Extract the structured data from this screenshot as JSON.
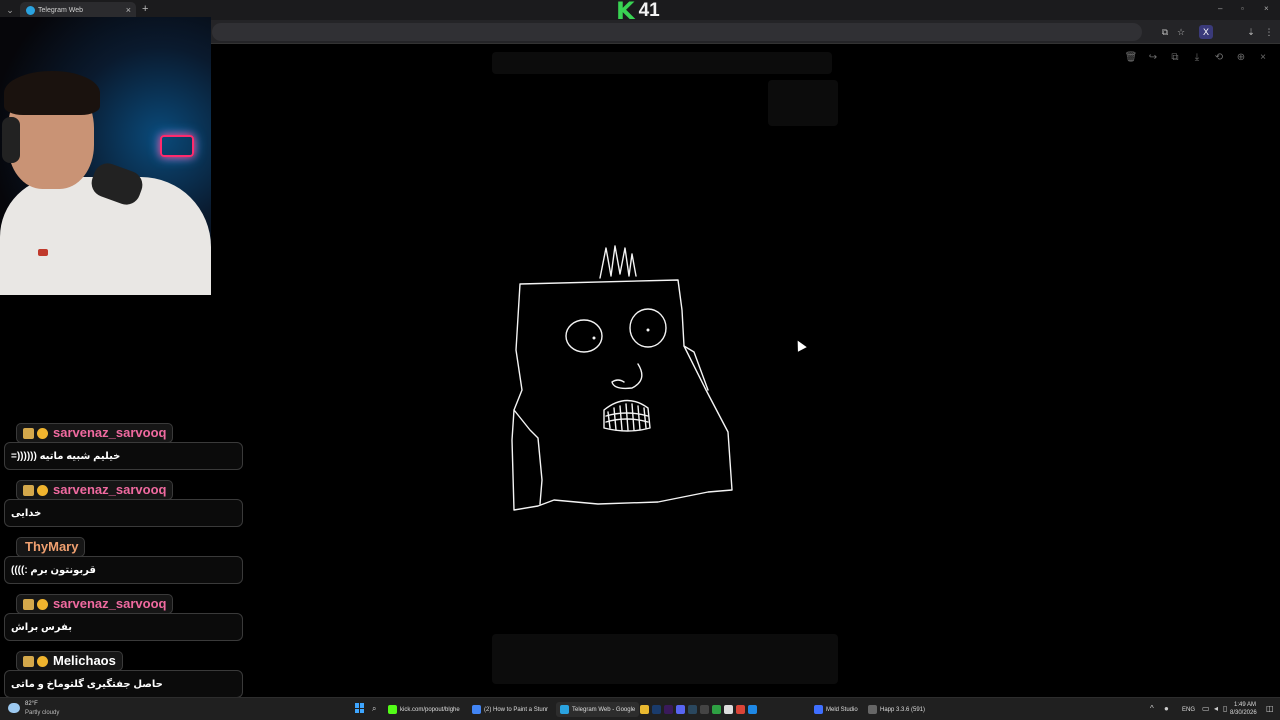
{
  "browser": {
    "tab_title": "Telegram Web",
    "tab_close": "×",
    "new_tab": "+",
    "tab_menu": "⌄",
    "window_controls": [
      "–",
      "▫",
      "×"
    ],
    "toolbar_icons": [
      "⧉",
      "☆",
      "X",
      "⇣",
      "⋮"
    ]
  },
  "overlay_score": {
    "logo": "K",
    "value": "41"
  },
  "viewer": {
    "tools": [
      "🗑",
      "↪",
      "⧉",
      "⤓",
      "⟲",
      "⊕",
      "×"
    ],
    "image_subject": "white line drawing of a square creature with spiky hair, oval eyes, nose and toothy mouth"
  },
  "chat": [
    {
      "username": "sarvenaz_sarvooq",
      "username_color": "#f06aa0",
      "badges": true,
      "message": "خیلیم شبیه ماتیه ((((((="
    },
    {
      "username": "sarvenaz_sarvooq",
      "username_color": "#f06aa0",
      "badges": true,
      "message": "خدایی"
    },
    {
      "username": "ThyMary",
      "username_color": "#f0a070",
      "badges": false,
      "message": "قربونتون برم :))))"
    },
    {
      "username": "sarvenaz_sarvooq",
      "username_color": "#f06aa0",
      "badges": true,
      "message": "بفرس براش"
    },
    {
      "username": "Melichaos",
      "username_color": "#ffffff",
      "badges": true,
      "message": "حاصل جفتگیری گلتوماخ و ماتی"
    }
  ],
  "taskbar": {
    "weather_temp": "82°F",
    "weather_condition": "Partly cloudy",
    "apps": [
      {
        "label": "kick.com/popout/blghe",
        "icon_color": "#53fc18"
      },
      {
        "label": "(2) How to Paint a Stunr",
        "icon_color": "#4285f4"
      },
      {
        "label": "Telegram Web - Google",
        "icon_color": "#2aa3e0"
      },
      {
        "label": "Meld Studio",
        "icon_color": "#3f6fff"
      },
      {
        "label": "Happ 3.3.6 (591)",
        "icon_color": "#666666"
      }
    ],
    "language": "ENG",
    "time": "1:49 AM",
    "date": "8/30/2026"
  }
}
